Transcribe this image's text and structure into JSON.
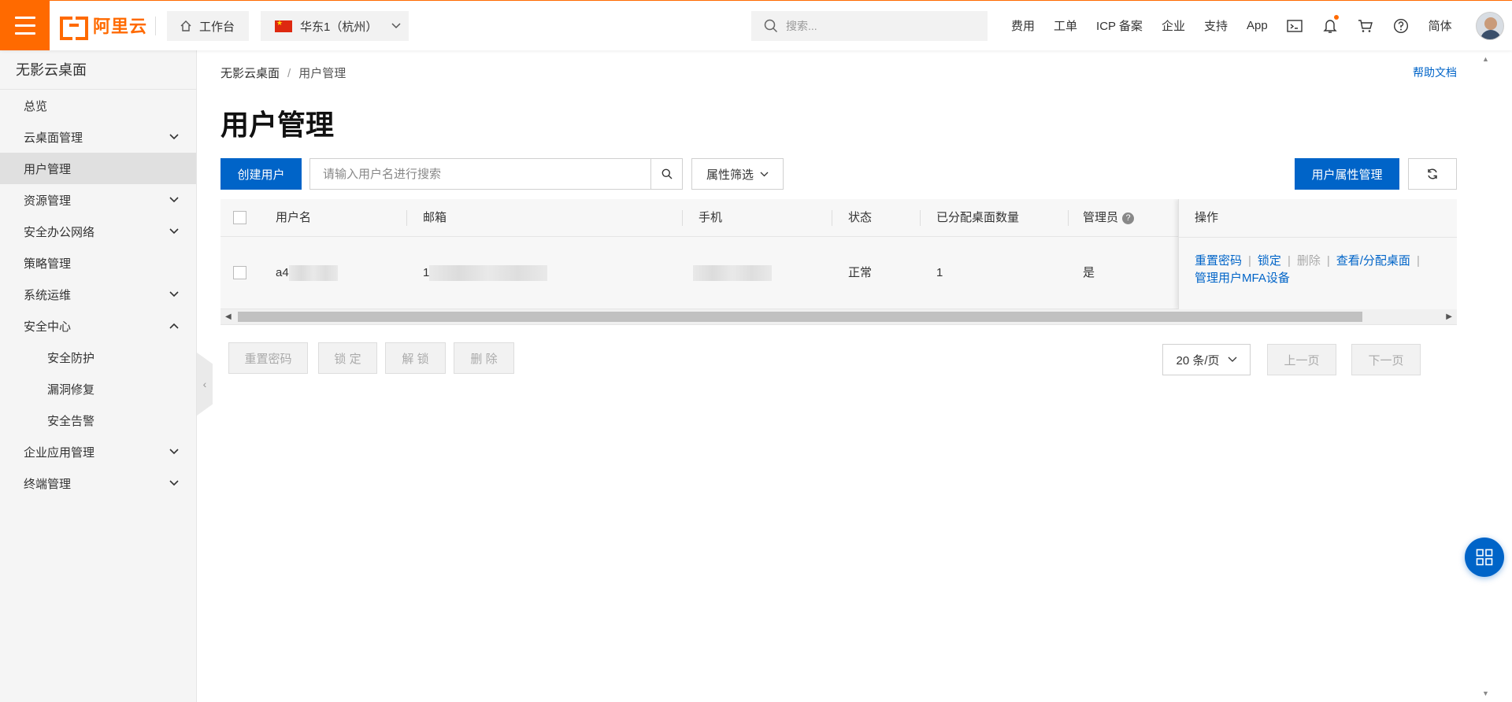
{
  "header": {
    "logo_text": "阿里云",
    "workbench_label": "工作台",
    "region_label": "华东1（杭州）",
    "search_placeholder": "搜索...",
    "nav": [
      "费用",
      "工单",
      "ICP 备案",
      "企业",
      "支持",
      "App"
    ],
    "lang_label": "简体",
    "icons": [
      "terminal-icon",
      "bell-icon",
      "cart-icon",
      "help-icon"
    ],
    "accent_color": "#ff6a00"
  },
  "sidebar": {
    "title": "无影云桌面",
    "items": [
      {
        "label": "总览",
        "expandable": false
      },
      {
        "label": "云桌面管理",
        "expandable": true,
        "expanded": false
      },
      {
        "label": "用户管理",
        "expandable": false,
        "active": true
      },
      {
        "label": "资源管理",
        "expandable": true,
        "expanded": false
      },
      {
        "label": "安全办公网络",
        "expandable": true,
        "expanded": false
      },
      {
        "label": "策略管理",
        "expandable": false
      },
      {
        "label": "系统运维",
        "expandable": true,
        "expanded": false
      },
      {
        "label": "安全中心",
        "expandable": true,
        "expanded": true
      },
      {
        "label": "安全防护",
        "sub": true
      },
      {
        "label": "漏洞修复",
        "sub": true
      },
      {
        "label": "安全告警",
        "sub": true
      },
      {
        "label": "企业应用管理",
        "expandable": true,
        "expanded": false
      },
      {
        "label": "终端管理",
        "expandable": true,
        "expanded": false
      }
    ]
  },
  "breadcrumb": [
    "无影云桌面",
    "用户管理"
  ],
  "help_link": "帮助文档",
  "page_title": "用户管理",
  "toolbar": {
    "create_label": "创建用户",
    "search_placeholder": "请输入用户名进行搜索",
    "filter_label": "属性筛选",
    "attr_manage_label": "用户属性管理"
  },
  "table": {
    "columns": [
      "用户名",
      "邮箱",
      "手机",
      "状态",
      "已分配桌面数量",
      "管理员",
      "操作"
    ],
    "rows": [
      {
        "username": "a4",
        "email": "1",
        "phone": "",
        "status": "正常",
        "desktops": "1",
        "admin": "是",
        "actions": {
          "reset_pwd": "重置密码",
          "lock": "锁定",
          "delete": "删除",
          "view_assign": "查看/分配桌面",
          "mfa": "管理用户MFA设备"
        }
      }
    ]
  },
  "bulk_actions": [
    "重置密码",
    "锁 定",
    "解 锁",
    "删 除"
  ],
  "pagination": {
    "page_size": "20 条/页",
    "prev": "上一页",
    "next": "下一页"
  },
  "link_color": "#0064c8"
}
